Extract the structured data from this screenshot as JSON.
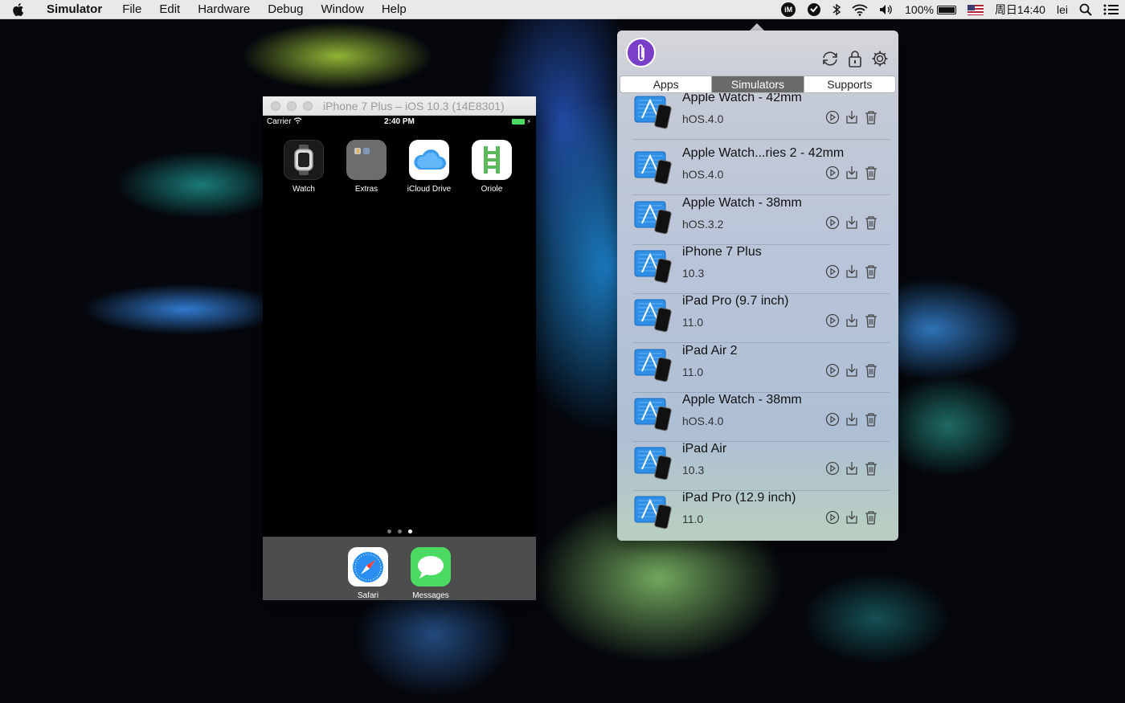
{
  "menubar": {
    "app_name": "Simulator",
    "items": [
      "File",
      "Edit",
      "Hardware",
      "Debug",
      "Window",
      "Help"
    ],
    "status": {
      "im_badge": "iM",
      "battery": "100%",
      "clock": "周日14:40",
      "user": "lei"
    }
  },
  "simulator": {
    "title": "iPhone 7 Plus – iOS 10.3 (14E8301)",
    "status_bar": {
      "carrier": "Carrier",
      "time": "2:40 PM"
    },
    "apps": [
      {
        "label": "Watch",
        "icon": "watch-icon"
      },
      {
        "label": "Extras",
        "icon": "folder-icon"
      },
      {
        "label": "iCloud Drive",
        "icon": "cloud-icon"
      },
      {
        "label": "Oriole",
        "icon": "ladder-icon"
      }
    ],
    "page_count": 3,
    "active_page": 3,
    "dock": [
      {
        "label": "Safari",
        "icon": "compass-icon"
      },
      {
        "label": "Messages",
        "icon": "message-bubble-icon"
      }
    ]
  },
  "panel": {
    "tabs": [
      "Apps",
      "Simulators",
      "Supports"
    ],
    "active_tab": "Simulators",
    "simulators": [
      {
        "name": "Apple Watch - 42mm",
        "version": "hOS.4.0"
      },
      {
        "name": "Apple Watch...ries 2 - 42mm",
        "version": "hOS.4.0"
      },
      {
        "name": "Apple Watch - 38mm",
        "version": "hOS.3.2"
      },
      {
        "name": "iPhone 7 Plus",
        "version": "10.3"
      },
      {
        "name": "iPad Pro (9.7 inch)",
        "version": "11.0"
      },
      {
        "name": "iPad Air 2",
        "version": "11.0"
      },
      {
        "name": "Apple Watch - 38mm",
        "version": "hOS.4.0"
      },
      {
        "name": "iPad Air",
        "version": "10.3"
      },
      {
        "name": "iPad Pro (12.9 inch)",
        "version": "11.0"
      }
    ]
  }
}
